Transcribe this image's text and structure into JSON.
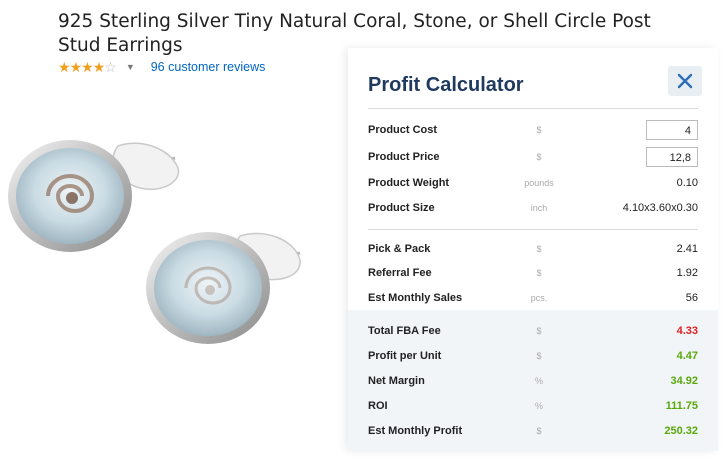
{
  "product": {
    "title": "925 Sterling Silver Tiny Natural Coral, Stone, or Shell Circle Post Stud Earrings",
    "rating": 3.5,
    "reviews_link": "96 customer reviews"
  },
  "calculator": {
    "title": "Profit Calculator",
    "close_icon": "close-icon",
    "rows_top": [
      {
        "label": "Product Cost",
        "unit": "$",
        "value": "4",
        "editable": true
      },
      {
        "label": "Product Price",
        "unit": "$",
        "value": "12,8",
        "editable": true
      },
      {
        "label": "Product Weight",
        "unit": "pounds",
        "value": "0.10",
        "editable": false
      },
      {
        "label": "Product Size",
        "unit": "inch",
        "value": "4.10x3.60x0.30",
        "editable": false
      }
    ],
    "rows_mid": [
      {
        "label": "Pick & Pack",
        "unit": "$",
        "value": "2.41"
      },
      {
        "label": "Referral Fee",
        "unit": "$",
        "value": "1.92"
      },
      {
        "label": "Est Monthly Sales",
        "unit": "pcs.",
        "value": "56"
      }
    ],
    "rows_bottom": [
      {
        "label": "Total FBA Fee",
        "unit": "$",
        "value": "4.33",
        "color": "#e02020"
      },
      {
        "label": "Profit per Unit",
        "unit": "$",
        "value": "4.47",
        "color": "#5aa80a"
      },
      {
        "label": "Net Margin",
        "unit": "%",
        "value": "34.92",
        "color": "#5aa80a"
      },
      {
        "label": "ROI",
        "unit": "%",
        "value": "111.75",
        "color": "#5aa80a"
      },
      {
        "label": "Est Monthly Profit",
        "unit": "$",
        "value": "250.32",
        "color": "#5aa80a"
      }
    ]
  },
  "colors": {
    "star": "#f0a020",
    "link": "#0066c0",
    "calc_title": "#1f3a5e",
    "close": "#2a6fb8"
  }
}
